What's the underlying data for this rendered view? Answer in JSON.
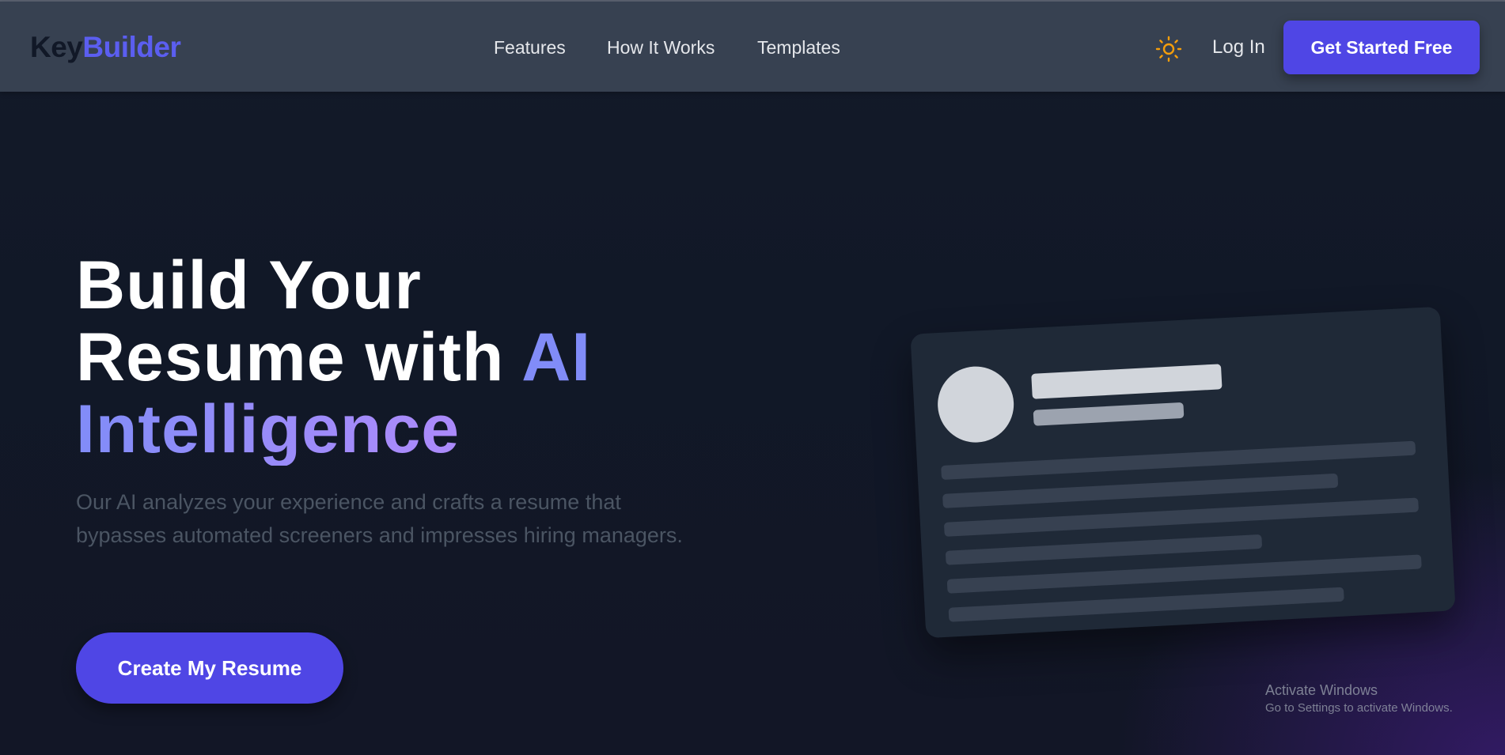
{
  "brand": {
    "logo_part1": "Key",
    "logo_part2": "Builder",
    "accent_color": "#4f46e5",
    "logo_accent_color": "#5b5ef0"
  },
  "nav": {
    "links": [
      {
        "label": "Features"
      },
      {
        "label": "How It Works"
      },
      {
        "label": "Templates"
      }
    ],
    "theme_toggle_icon": "sun-icon",
    "theme_icon_color": "#f59e0b",
    "login_label": "Log In",
    "cta_label": "Get Started Free"
  },
  "hero": {
    "title_line1": "Build Your",
    "title_line2_prefix": "Resume with ",
    "title_line2_accent": "AI",
    "title_line3": "Intelligence",
    "subtitle": "Our AI analyzes your experience and crafts a resume that bypasses automated screeners and impresses hiring managers.",
    "cta_label": "Create My Resume"
  },
  "mockup": {
    "kind": "resume-preview-card"
  },
  "watermark": {
    "title": "Activate Windows",
    "subtitle": "Go to Settings to activate Windows."
  }
}
